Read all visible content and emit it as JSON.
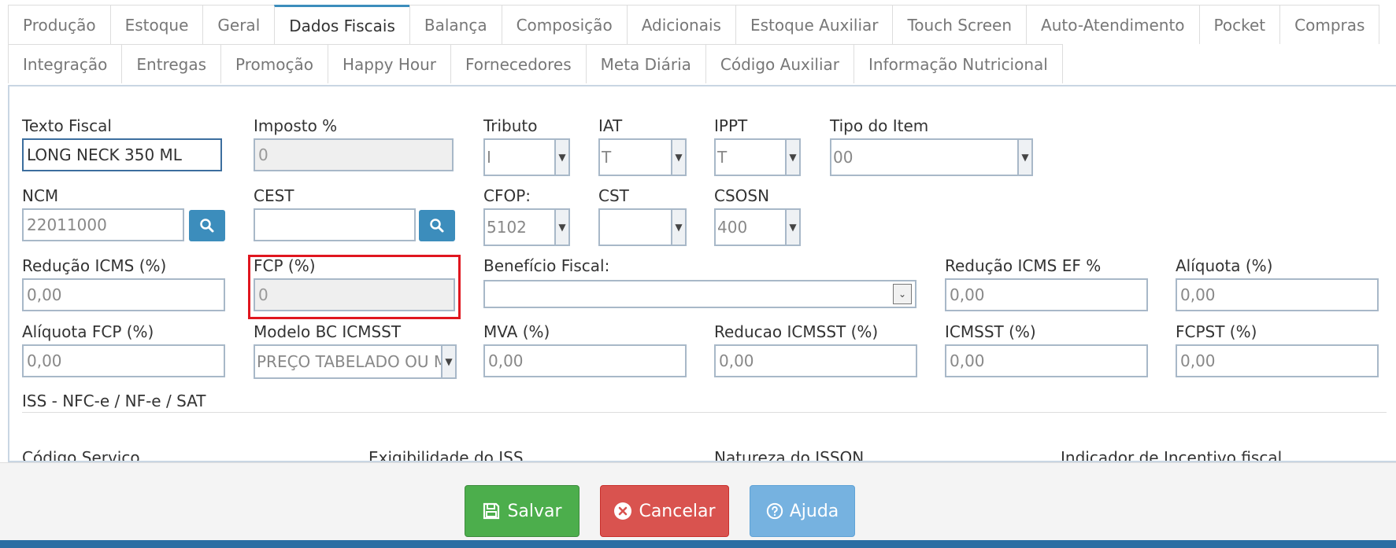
{
  "tabs": {
    "row1": [
      "Produção",
      "Estoque",
      "Geral",
      "Dados Fiscais",
      "Balança",
      "Composição",
      "Adicionais",
      "Estoque Auxiliar",
      "Touch Screen",
      "Auto-Atendimento",
      "Pocket",
      "Compras"
    ],
    "row2": [
      "Integração",
      "Entregas",
      "Promoção",
      "Happy Hour",
      "Fornecedores",
      "Meta Diária",
      "Código Auxiliar",
      "Informação Nutricional"
    ],
    "active": "Dados Fiscais"
  },
  "form": {
    "texto_fiscal": {
      "label": "Texto Fiscal",
      "value": "LONG NECK 350 ML"
    },
    "imposto": {
      "label": "Imposto %",
      "value": "0"
    },
    "tributo": {
      "label": "Tributo",
      "value": "I"
    },
    "iat": {
      "label": "IAT",
      "value": "T"
    },
    "ippt": {
      "label": "IPPT",
      "value": "T"
    },
    "tipo_item": {
      "label": "Tipo do Item",
      "value": "00"
    },
    "ncm": {
      "label": "NCM",
      "value": "22011000"
    },
    "cest": {
      "label": "CEST",
      "value": ""
    },
    "cfop": {
      "label": "CFOP:",
      "value": "5102"
    },
    "cst": {
      "label": "CST",
      "value": ""
    },
    "csosn": {
      "label": "CSOSN",
      "value": "400"
    },
    "reducao_icms": {
      "label": "Redução ICMS (%)",
      "value": "0,00"
    },
    "fcp": {
      "label": "FCP (%)",
      "value": "0"
    },
    "beneficio_fiscal": {
      "label": "Benefício Fiscal:",
      "value": ""
    },
    "reducao_icms_ef": {
      "label": "Redução ICMS EF %",
      "value": "0,00"
    },
    "aliquota": {
      "label": "Alíquota (%)",
      "value": "0,00"
    },
    "aliquota_fcp": {
      "label": "Alíquota FCP (%)",
      "value": "0,00"
    },
    "modelo_bc": {
      "label": "Modelo BC ICMSST",
      "value": "PREÇO TABELADO OU MÁXIMO"
    },
    "mva": {
      "label": "MVA (%)",
      "value": "0,00"
    },
    "reducao_icmsst": {
      "label": "Reducao ICMSST (%)",
      "value": "0,00"
    },
    "icmsst": {
      "label": "ICMSST (%)",
      "value": "0,00"
    },
    "fcpst": {
      "label": "FCPST (%)",
      "value": "0,00"
    }
  },
  "iss": {
    "title": "ISS - NFC-e / NF-e / SAT",
    "codigo_servico": "Código Servico",
    "exigibilidade": "Exigibilidade do ISS",
    "natureza": "Natureza do ISSQN",
    "indicador": "Indicador de Incentivo fiscal"
  },
  "footer": {
    "save": "Salvar",
    "cancel": "Cancelar",
    "help": "Ajuda"
  },
  "colors": {
    "save": "#4cae4c",
    "cancel": "#d9534f",
    "help": "#76b2e0",
    "accent": "#3c8dbc",
    "highlight": "#e0161f"
  }
}
